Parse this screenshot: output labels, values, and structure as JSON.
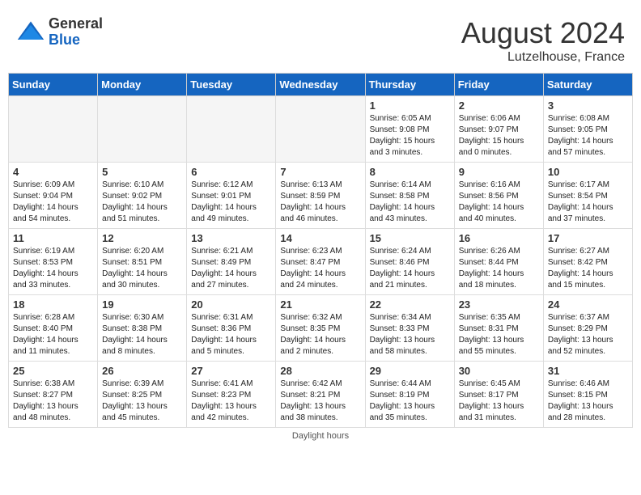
{
  "header": {
    "logo_general": "General",
    "logo_blue": "Blue",
    "month_year": "August 2024",
    "location": "Lutzelhouse, France"
  },
  "days_of_week": [
    "Sunday",
    "Monday",
    "Tuesday",
    "Wednesday",
    "Thursday",
    "Friday",
    "Saturday"
  ],
  "weeks": [
    [
      {
        "day": "",
        "empty": true
      },
      {
        "day": "",
        "empty": true
      },
      {
        "day": "",
        "empty": true
      },
      {
        "day": "",
        "empty": true
      },
      {
        "day": "1",
        "sunrise": "6:05 AM",
        "sunset": "9:08 PM",
        "daylight": "15 hours and 3 minutes."
      },
      {
        "day": "2",
        "sunrise": "6:06 AM",
        "sunset": "9:07 PM",
        "daylight": "15 hours and 0 minutes."
      },
      {
        "day": "3",
        "sunrise": "6:08 AM",
        "sunset": "9:05 PM",
        "daylight": "14 hours and 57 minutes."
      }
    ],
    [
      {
        "day": "4",
        "sunrise": "6:09 AM",
        "sunset": "9:04 PM",
        "daylight": "14 hours and 54 minutes."
      },
      {
        "day": "5",
        "sunrise": "6:10 AM",
        "sunset": "9:02 PM",
        "daylight": "14 hours and 51 minutes."
      },
      {
        "day": "6",
        "sunrise": "6:12 AM",
        "sunset": "9:01 PM",
        "daylight": "14 hours and 49 minutes."
      },
      {
        "day": "7",
        "sunrise": "6:13 AM",
        "sunset": "8:59 PM",
        "daylight": "14 hours and 46 minutes."
      },
      {
        "day": "8",
        "sunrise": "6:14 AM",
        "sunset": "8:58 PM",
        "daylight": "14 hours and 43 minutes."
      },
      {
        "day": "9",
        "sunrise": "6:16 AM",
        "sunset": "8:56 PM",
        "daylight": "14 hours and 40 minutes."
      },
      {
        "day": "10",
        "sunrise": "6:17 AM",
        "sunset": "8:54 PM",
        "daylight": "14 hours and 37 minutes."
      }
    ],
    [
      {
        "day": "11",
        "sunrise": "6:19 AM",
        "sunset": "8:53 PM",
        "daylight": "14 hours and 33 minutes."
      },
      {
        "day": "12",
        "sunrise": "6:20 AM",
        "sunset": "8:51 PM",
        "daylight": "14 hours and 30 minutes."
      },
      {
        "day": "13",
        "sunrise": "6:21 AM",
        "sunset": "8:49 PM",
        "daylight": "14 hours and 27 minutes."
      },
      {
        "day": "14",
        "sunrise": "6:23 AM",
        "sunset": "8:47 PM",
        "daylight": "14 hours and 24 minutes."
      },
      {
        "day": "15",
        "sunrise": "6:24 AM",
        "sunset": "8:46 PM",
        "daylight": "14 hours and 21 minutes."
      },
      {
        "day": "16",
        "sunrise": "6:26 AM",
        "sunset": "8:44 PM",
        "daylight": "14 hours and 18 minutes."
      },
      {
        "day": "17",
        "sunrise": "6:27 AM",
        "sunset": "8:42 PM",
        "daylight": "14 hours and 15 minutes."
      }
    ],
    [
      {
        "day": "18",
        "sunrise": "6:28 AM",
        "sunset": "8:40 PM",
        "daylight": "14 hours and 11 minutes."
      },
      {
        "day": "19",
        "sunrise": "6:30 AM",
        "sunset": "8:38 PM",
        "daylight": "14 hours and 8 minutes."
      },
      {
        "day": "20",
        "sunrise": "6:31 AM",
        "sunset": "8:36 PM",
        "daylight": "14 hours and 5 minutes."
      },
      {
        "day": "21",
        "sunrise": "6:32 AM",
        "sunset": "8:35 PM",
        "daylight": "14 hours and 2 minutes."
      },
      {
        "day": "22",
        "sunrise": "6:34 AM",
        "sunset": "8:33 PM",
        "daylight": "13 hours and 58 minutes."
      },
      {
        "day": "23",
        "sunrise": "6:35 AM",
        "sunset": "8:31 PM",
        "daylight": "13 hours and 55 minutes."
      },
      {
        "day": "24",
        "sunrise": "6:37 AM",
        "sunset": "8:29 PM",
        "daylight": "13 hours and 52 minutes."
      }
    ],
    [
      {
        "day": "25",
        "sunrise": "6:38 AM",
        "sunset": "8:27 PM",
        "daylight": "13 hours and 48 minutes."
      },
      {
        "day": "26",
        "sunrise": "6:39 AM",
        "sunset": "8:25 PM",
        "daylight": "13 hours and 45 minutes."
      },
      {
        "day": "27",
        "sunrise": "6:41 AM",
        "sunset": "8:23 PM",
        "daylight": "13 hours and 42 minutes."
      },
      {
        "day": "28",
        "sunrise": "6:42 AM",
        "sunset": "8:21 PM",
        "daylight": "13 hours and 38 minutes."
      },
      {
        "day": "29",
        "sunrise": "6:44 AM",
        "sunset": "8:19 PM",
        "daylight": "13 hours and 35 minutes."
      },
      {
        "day": "30",
        "sunrise": "6:45 AM",
        "sunset": "8:17 PM",
        "daylight": "13 hours and 31 minutes."
      },
      {
        "day": "31",
        "sunrise": "6:46 AM",
        "sunset": "8:15 PM",
        "daylight": "13 hours and 28 minutes."
      }
    ]
  ],
  "footer": {
    "daylight_note": "Daylight hours"
  }
}
